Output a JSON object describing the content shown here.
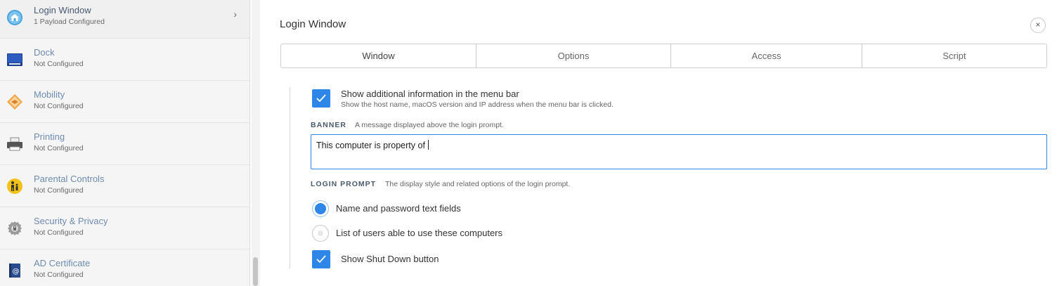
{
  "sidebar": {
    "items": [
      {
        "title": "Login Window",
        "subtitle": "1 Payload Configured",
        "icon": "home-icon"
      },
      {
        "title": "Dock",
        "subtitle": "Not Configured",
        "icon": "dock-icon"
      },
      {
        "title": "Mobility",
        "subtitle": "Not Configured",
        "icon": "mobility-icon"
      },
      {
        "title": "Printing",
        "subtitle": "Not Configured",
        "icon": "printer-icon"
      },
      {
        "title": "Parental Controls",
        "subtitle": "Not Configured",
        "icon": "parental-controls-icon"
      },
      {
        "title": "Security & Privacy",
        "subtitle": "Not Configured",
        "icon": "security-icon"
      },
      {
        "title": "AD Certificate",
        "subtitle": "Not Configured",
        "icon": "certificate-icon"
      }
    ],
    "chevron": "›"
  },
  "main": {
    "title": "Login Window",
    "close": "×",
    "tabs": [
      {
        "label": "Window"
      },
      {
        "label": "Options"
      },
      {
        "label": "Access"
      },
      {
        "label": "Script"
      }
    ],
    "menu_bar_info": {
      "label": "Show additional information in the menu bar",
      "help": "Show the host name, macOS version and IP address when the menu bar is clicked.",
      "checked": true
    },
    "banner": {
      "label": "BANNER",
      "help": "A message displayed above the login prompt.",
      "value": "This computer is property of "
    },
    "login_prompt": {
      "label": "LOGIN PROMPT",
      "help": "The display style and related options of the login prompt.",
      "options": [
        {
          "label": "Name and password text fields",
          "selected": true
        },
        {
          "label": "List of users able to use these computers",
          "selected": false
        }
      ]
    },
    "shutdown": {
      "label": "Show Shut Down button",
      "checked": true
    }
  },
  "colors": {
    "accent": "#2e86e6",
    "sidebar_bg": "#f5f5f5",
    "link": "#6f8bb0"
  }
}
